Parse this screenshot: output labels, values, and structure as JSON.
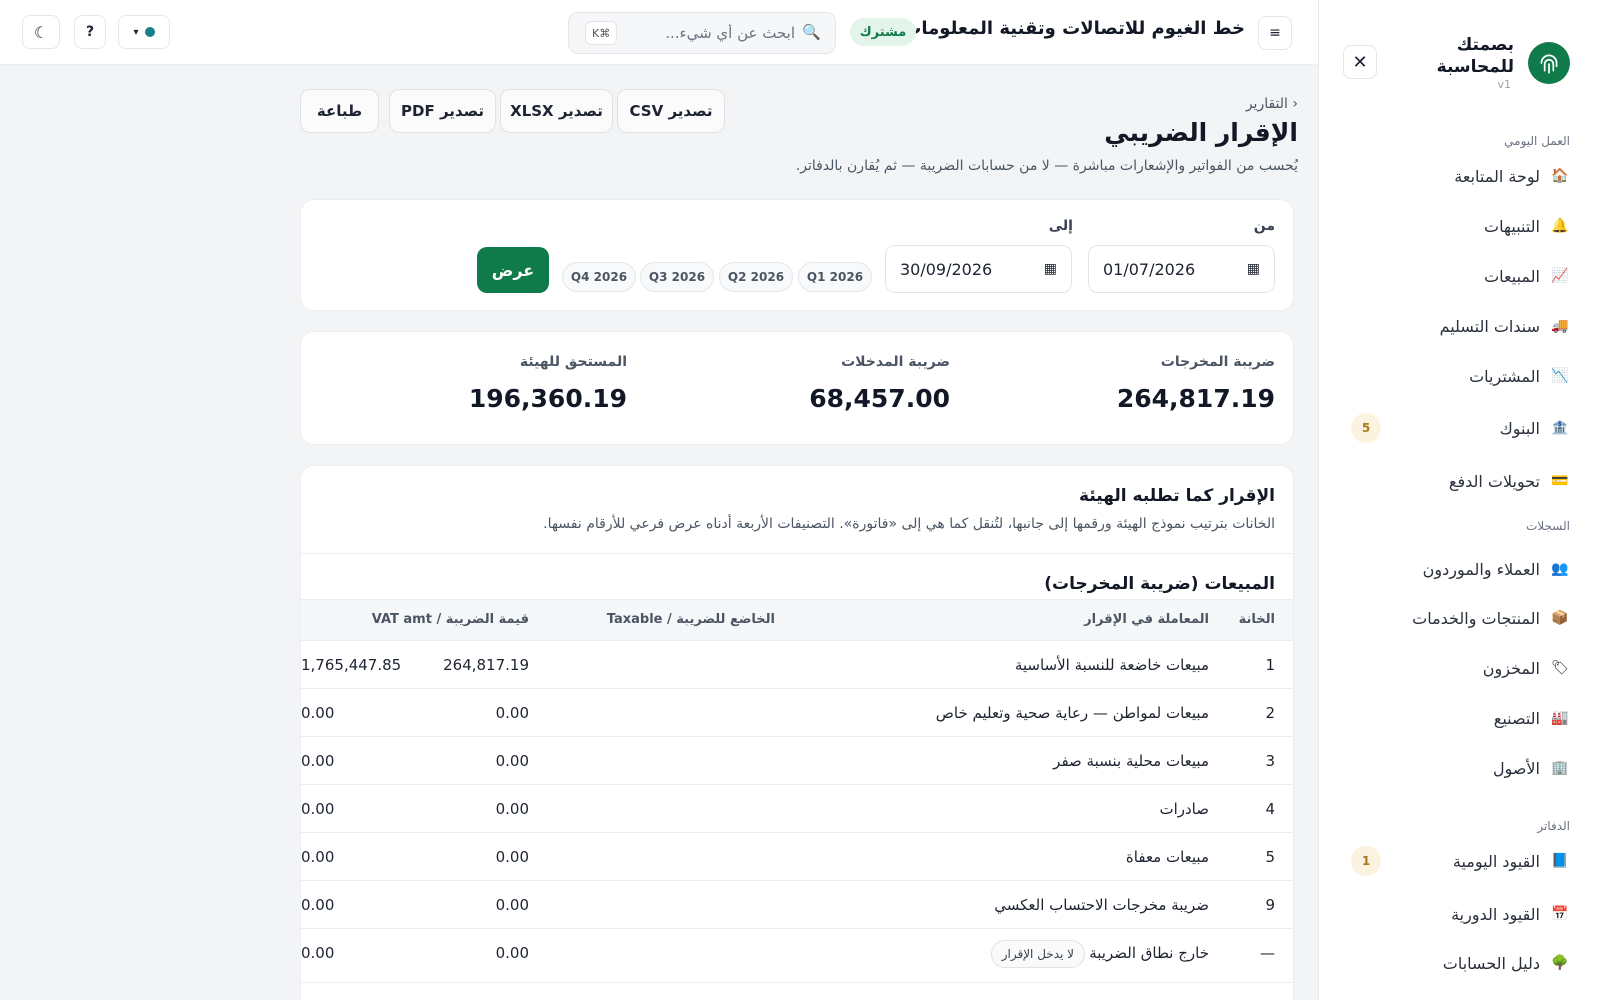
{
  "sidebar": {
    "brand_name": "بصمتك للمحاسبة",
    "version": "v1",
    "close": "✕",
    "sections": {
      "daily": "العمل اليومي",
      "records": "السجلات",
      "books": "الدفاتر"
    },
    "items": [
      {
        "label": "لوحة المتابعة",
        "icon": "house-icon",
        "glyph": "🏠"
      },
      {
        "label": "التنبيهات",
        "icon": "bell-icon",
        "glyph": "🔔"
      },
      {
        "label": "المبيعات",
        "icon": "chart-up-icon",
        "glyph": "📈"
      },
      {
        "label": "سندات التسليم",
        "icon": "truck-icon",
        "glyph": "🚚"
      },
      {
        "label": "المشتريات",
        "icon": "chart-down-icon",
        "glyph": "📉"
      },
      {
        "label": "البنوك",
        "icon": "bank-icon",
        "glyph": "🏦",
        "badge": "5"
      },
      {
        "label": "تحويلات الدفع",
        "icon": "card-icon",
        "glyph": "💳"
      },
      {
        "label": "العملاء والموردون",
        "icon": "people-icon",
        "glyph": "👥"
      },
      {
        "label": "المنتجات والخدمات",
        "icon": "package-icon",
        "glyph": "📦"
      },
      {
        "label": "المخزون",
        "icon": "tag-icon",
        "glyph": "🏷"
      },
      {
        "label": "التصنيع",
        "icon": "factory-icon",
        "glyph": "🏭"
      },
      {
        "label": "الأصول",
        "icon": "building-icon",
        "glyph": "🏢"
      },
      {
        "label": "القيود اليومية",
        "icon": "book-icon",
        "glyph": "📘",
        "badge": "1"
      },
      {
        "label": "القيود الدورية",
        "icon": "calendar-icon",
        "glyph": "📅"
      },
      {
        "label": "دليل الحسابات",
        "icon": "tree-icon",
        "glyph": "🌳"
      }
    ]
  },
  "topbar": {
    "menu": "≡",
    "company": "خط الغيوم للاتصالات وتقنية المعلومات",
    "subscription": "مشترك",
    "search_placeholder": "ابحث عن أي شيء...",
    "search_icon": "🔍",
    "shortcut": "K⌘",
    "help": "?",
    "theme_icon": "☾",
    "status_caret": "▾"
  },
  "page": {
    "breadcrumb": "‹ التقارير",
    "title": "الإقرار الضريبي",
    "description": "يُحسب من الفواتير والإشعارات مباشرة — لا من حسابات الضريبة — ثم يُقارن بالدفاتر.",
    "exports": {
      "csv": "تصدير CSV",
      "xlsx": "تصدير XLSX",
      "pdf": "تصدير PDF",
      "print": "طباعة"
    }
  },
  "filter": {
    "from_label": "من",
    "to_label": "إلى",
    "from_value": "01/07/2026",
    "to_value": "30/09/2026",
    "quarters": [
      "Q1 2026",
      "Q2 2026",
      "Q3 2026",
      "Q4 2026"
    ],
    "show": "عرض"
  },
  "summary": {
    "output_label": "ضريبة المخرجات",
    "output_value": "264,817.19",
    "input_label": "ضريبة المدخلات",
    "input_value": "68,457.00",
    "due_label": "المستحق للهيئة",
    "due_value": "196,360.19"
  },
  "declaration": {
    "title": "الإقرار كما تطلبه الهيئة",
    "description": "الخانات بترتيب نموذج الهيئة ورقمها إلى جانبها، لتُنقل كما هي إلى «فاتورة». التصنيفات الأربعة أدناه عرض فرعي للأرقام نفسها.",
    "table_title": "المبيعات (ضريبة المخرجات)",
    "headers": {
      "box": "الخانة",
      "txn": "المعاملة في الإقرار",
      "taxable": "الخاضع للضريبة / Taxable",
      "vat": "قيمة الضريبة / VAT amt"
    },
    "rows": [
      {
        "box": "1",
        "desc": "مبيعات خاضعة للنسبة الأساسية",
        "taxable": "1,765,447.85",
        "vat": "264,817.19"
      },
      {
        "box": "2",
        "desc": "مبيعات لمواطن — رعاية صحية وتعليم خاص",
        "taxable": "0.00",
        "vat": "0.00"
      },
      {
        "box": "3",
        "desc": "مبيعات محلية بنسبة صفر",
        "taxable": "0.00",
        "vat": "0.00"
      },
      {
        "box": "4",
        "desc": "صادرات",
        "taxable": "0.00",
        "vat": "0.00"
      },
      {
        "box": "5",
        "desc": "مبيعات معفاة",
        "taxable": "0.00",
        "vat": "0.00"
      },
      {
        "box": "9",
        "desc": "ضريبة مخرجات الاحتساب العكسي",
        "taxable": "0.00",
        "vat": "0.00"
      },
      {
        "box": "—",
        "desc": "خارج نطاق الضريبة",
        "taxable": "0.00",
        "vat": "0.00",
        "badge": "لا يدخل الإقرار"
      }
    ]
  },
  "colors": {
    "accent": "#0f7a4a",
    "badge_bg": "#fbf3df",
    "badge_fg": "#a57b1d"
  }
}
